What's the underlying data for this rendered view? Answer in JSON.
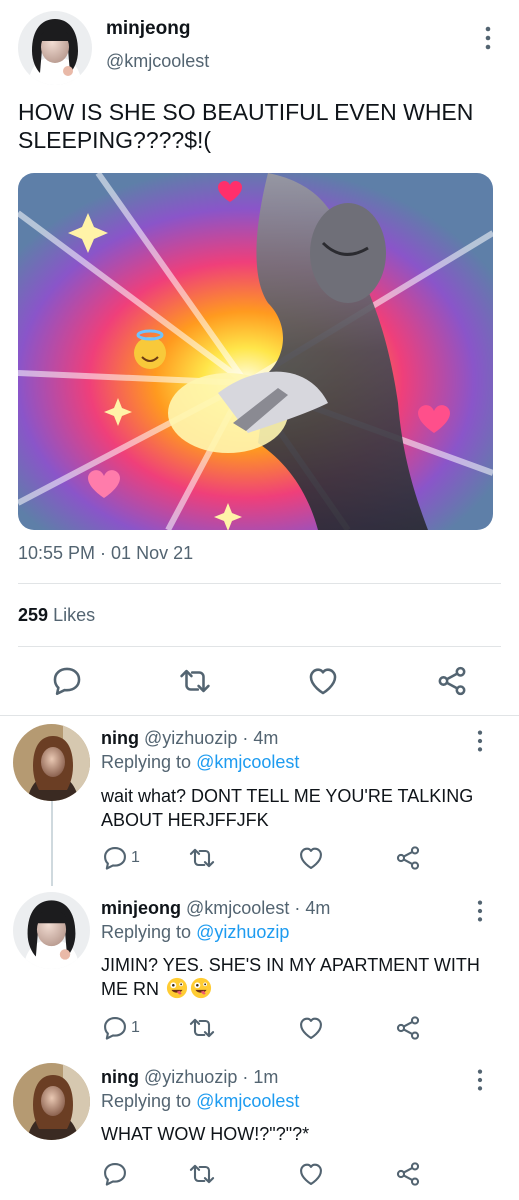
{
  "main_tweet": {
    "author_name": "minjeong",
    "author_handle": "@kmjcoolest",
    "text": "HOW IS SHE SO BEAUTIFUL EVEN WHEN SLEEPING????$!(",
    "timestamp": "10:55 PM · 01 Nov 21",
    "likes_count": "259",
    "likes_label": "Likes",
    "media_icons": [
      "sparkle-icon",
      "heart-icon",
      "smiling-face-with-halo-icon"
    ],
    "actions": [
      "reply-icon",
      "retweet-icon",
      "like-icon",
      "share-icon"
    ]
  },
  "replies": [
    {
      "name": "ning",
      "handle": "@yizhuozip",
      "time": "· 4m",
      "replying_prefix": "Replying to",
      "replying_to": "@kmjcoolest",
      "text": "wait what? DONT TELL ME YOU'RE TALKING ABOUT HERJFFJFK",
      "reply_count": "1",
      "emojis": []
    },
    {
      "name": "minjeong",
      "handle": "@kmjcoolest",
      "time": "· 4m",
      "replying_prefix": "Replying to",
      "replying_to": "@yizhuozip",
      "text": "JIMIN? YES. SHE'S IN MY APARTMENT WITH ME RN",
      "reply_count": "1",
      "emojis": [
        "zany-face-icon",
        "zany-face-icon"
      ]
    },
    {
      "name": "ning",
      "handle": "@yizhuozip",
      "time": "· 1m",
      "replying_prefix": "Replying to",
      "replying_to": "@kmjcoolest",
      "text": "WHAT WOW HOW!?\"?\"?*",
      "reply_count": "",
      "emojis": []
    }
  ],
  "colors": {
    "text": "#0f1419",
    "secondary": "#536471",
    "link": "#1d9bf0",
    "divider": "#e1e4e6"
  }
}
